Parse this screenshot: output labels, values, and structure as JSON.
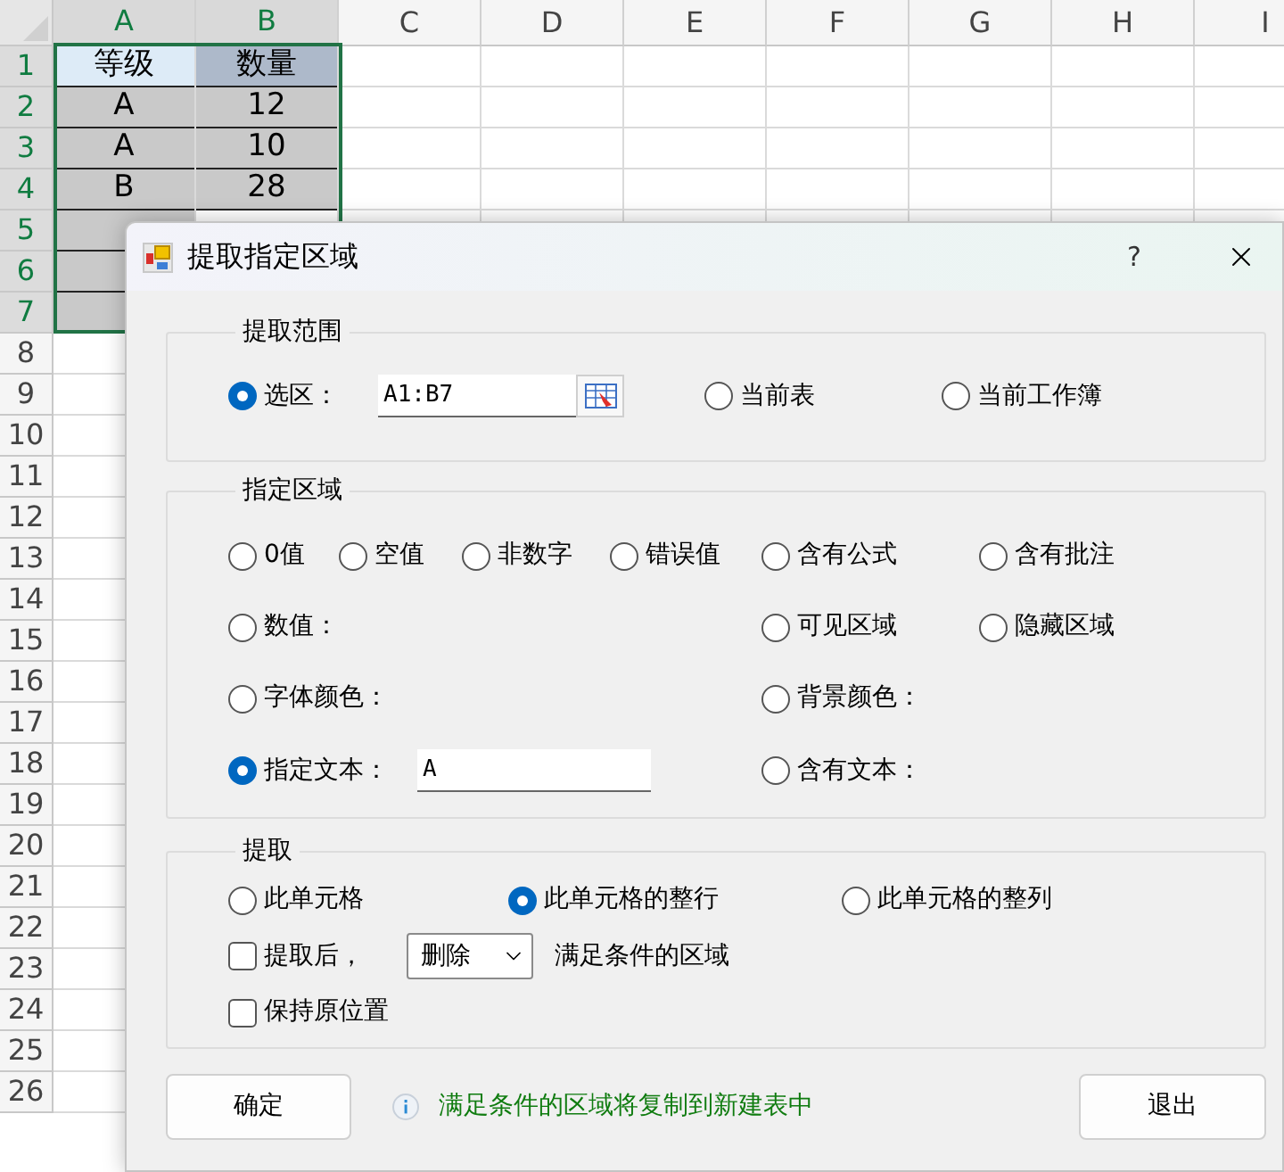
{
  "sheet": {
    "columns": [
      {
        "label": "A",
        "selected": true
      },
      {
        "label": "B",
        "selected": true
      },
      {
        "label": "C",
        "selected": false
      },
      {
        "label": "D",
        "selected": false
      },
      {
        "label": "E",
        "selected": false
      },
      {
        "label": "F",
        "selected": false
      },
      {
        "label": "G",
        "selected": false
      },
      {
        "label": "H",
        "selected": false
      },
      {
        "label": "I",
        "selected": false
      }
    ],
    "rows": [
      {
        "label": "1",
        "selected": true,
        "cells": [
          {
            "text": "等级",
            "color": "#ddebf7"
          },
          {
            "text": "数量",
            "color": "#adb9ca"
          }
        ]
      },
      {
        "label": "2",
        "selected": true,
        "cells": [
          {
            "text": "A",
            "color": "#c9c9c9"
          },
          {
            "text": "12",
            "color": "#c9c9c9"
          }
        ]
      },
      {
        "label": "3",
        "selected": true,
        "cells": [
          {
            "text": "A",
            "color": "#c9c9c9"
          },
          {
            "text": "10",
            "color": "#c9c9c9"
          }
        ]
      },
      {
        "label": "4",
        "selected": true,
        "cells": [
          {
            "text": "B",
            "color": "#c9c9c9"
          },
          {
            "text": "28",
            "color": "#c9c9c9"
          }
        ]
      },
      {
        "label": "5",
        "selected": true,
        "cells": [
          {
            "color": "#c9c9c9"
          }
        ]
      },
      {
        "label": "6",
        "selected": true,
        "cells": [
          {
            "color": "#c9c9c9"
          }
        ]
      },
      {
        "label": "7",
        "selected": true,
        "cells": [
          {
            "color": "#c9c9c9"
          }
        ]
      },
      {
        "label": "8",
        "selected": false
      },
      {
        "label": "9",
        "selected": false
      },
      {
        "label": "10",
        "selected": false
      },
      {
        "label": "11",
        "selected": false
      },
      {
        "label": "12",
        "selected": false
      },
      {
        "label": "13",
        "selected": false
      },
      {
        "label": "14",
        "selected": false
      },
      {
        "label": "15",
        "selected": false
      },
      {
        "label": "16",
        "selected": false
      },
      {
        "label": "17",
        "selected": false
      },
      {
        "label": "18",
        "selected": false
      },
      {
        "label": "19",
        "selected": false
      },
      {
        "label": "20",
        "selected": false
      },
      {
        "label": "21",
        "selected": false
      },
      {
        "label": "22",
        "selected": false
      },
      {
        "label": "23",
        "selected": false
      },
      {
        "label": "24",
        "selected": false
      },
      {
        "label": "25",
        "selected": false
      },
      {
        "label": "26",
        "selected": false
      }
    ]
  },
  "dialog": {
    "title": "提取指定区域",
    "help": "?",
    "range_group": {
      "title": "提取范围",
      "options": [
        {
          "label": "选区：",
          "selected": true,
          "value": "A1:B7"
        },
        {
          "label": "当前表",
          "selected": false
        },
        {
          "label": "当前工作簿",
          "selected": false
        }
      ]
    },
    "area_group": {
      "title": "指定区域",
      "rows": [
        [
          {
            "label": "0值",
            "selected": false
          },
          {
            "label": "空值",
            "selected": false
          },
          {
            "label": "非数字",
            "selected": false
          },
          {
            "label": "错误值",
            "selected": false
          },
          {
            "label": "含有公式",
            "selected": false
          },
          {
            "label": "含有批注",
            "selected": false
          }
        ],
        [
          {
            "label": "数值：",
            "selected": false
          },
          "",
          "",
          "",
          {
            "label": "可见区域",
            "selected": false
          },
          {
            "label": "隐藏区域",
            "selected": false
          }
        ],
        [
          {
            "label": "字体颜色：",
            "selected": false
          },
          "",
          "",
          "",
          {
            "label": "背景颜色：",
            "selected": false
          }
        ],
        [
          {
            "label": "指定文本：",
            "selected": true,
            "value": "A"
          },
          "",
          "",
          "",
          {
            "label": "含有文本：",
            "selected": false
          }
        ]
      ]
    },
    "extract_group": {
      "title": "提取",
      "options": [
        {
          "label": "此单元格",
          "selected": false
        },
        {
          "label": "此单元格的整行",
          "selected": true
        },
        {
          "label": "此单元格的整列",
          "selected": false
        }
      ],
      "after": {
        "label": "提取后，",
        "checked": false,
        "action": "删除",
        "suffix": "满足条件的区域"
      },
      "keep": {
        "label": "保持原位置",
        "checked": false
      }
    },
    "ok": "确定",
    "info": "满足条件的区域将复制到新建表中",
    "cancel": "退出"
  }
}
